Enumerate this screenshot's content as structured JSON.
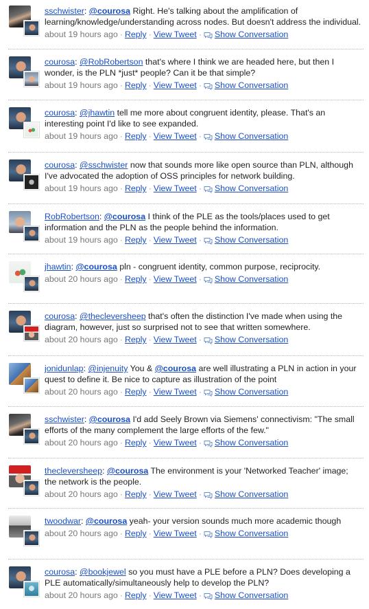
{
  "meta_labels": {
    "reply": "Reply",
    "view_tweet": "View Tweet",
    "show_conversation": "Show Conversation"
  },
  "tweets": [
    {
      "author": "sschwister",
      "sep": ": ",
      "mention": "@courosa",
      "mention_bold": true,
      "text": " Right. He's talking about the amplification of learning/knowledge/understanding across nodes. But doesn't address the individual.",
      "time": "about 19 hours ago",
      "avatar_main": "face-dark",
      "avatar_reply": "face-couro"
    },
    {
      "author": "courosa",
      "sep": ": ",
      "mention": "@RobRobertson",
      "mention_bold": false,
      "text": " that's where I think we are headed here, but then I wonder, is the PLN *just* people? Can it be that simple?",
      "time": "about 19 hours ago",
      "avatar_main": "face-couro",
      "avatar_reply": "face-rob"
    },
    {
      "author": "courosa",
      "sep": ": ",
      "mention": "@jhawtin",
      "mention_bold": false,
      "text": " tell me more about congruent identity, please. That's an interesting point I'd like to see expanded.",
      "time": "about 19 hours ago",
      "avatar_main": "face-couro",
      "avatar_reply": "face-jh"
    },
    {
      "author": "courosa",
      "sep": ": ",
      "mention": "@sschwister",
      "mention_bold": false,
      "text": " now that sounds more like open source than PLN, although I've advocated the adoption of OSS principles for network building.",
      "time": "about 19 hours ago",
      "avatar_main": "face-couro",
      "avatar_reply": "face-ssch-small"
    },
    {
      "author": "RobRobertson",
      "sep": ": ",
      "mention": "@courosa",
      "mention_bold": true,
      "text": " I think of the PLE as the tools/places used to get information and the PLN as the people behind the information.",
      "time": "about 19 hours ago",
      "avatar_main": "face-rob",
      "avatar_reply": "face-couro"
    },
    {
      "author": "jhawtin",
      "sep": ": ",
      "mention": "@courosa",
      "mention_bold": true,
      "text": " pln - congruent identity, common purpose, reciprocity.",
      "time": "about 20 hours ago",
      "avatar_main": "face-jh",
      "avatar_reply": "face-couro"
    },
    {
      "author": "courosa",
      "sep": ": ",
      "mention": "@thecleversheep",
      "mention_bold": false,
      "text": " that's often the distinction I've made when using the diagram, however, just so surprised not to see that written somewhere.",
      "time": "about 20 hours ago",
      "avatar_main": "face-couro",
      "avatar_reply": "face-sheep"
    },
    {
      "author": "jonidunlap",
      "sep": ": ",
      "mention": "@injenuity",
      "mention_bold": false,
      "mid": " You & ",
      "mention2": "@courosa",
      "text": " are well illustrating a PLN in action in your quest to define it. Be nice to capture as illustration of the point",
      "time": "about 20 hours ago",
      "avatar_main": "face-jon",
      "avatar_reply": "face-jon"
    },
    {
      "author": "sschwister",
      "sep": ": ",
      "mention": "@courosa",
      "mention_bold": true,
      "text": " I'd add Seely Brown via Siemens' connectivism: \"The small efforts of the many complement the large efforts of the few.\"",
      "time": "about 20 hours ago",
      "avatar_main": "face-dark",
      "avatar_reply": "face-couro"
    },
    {
      "author": "thecleversheep",
      "sep": ": ",
      "mention": "@courosa",
      "mention_bold": true,
      "text": " The environment is your 'Networked Teacher' image; the network is the people.",
      "time": "about 20 hours ago",
      "avatar_main": "face-sheep",
      "avatar_reply": "face-couro"
    },
    {
      "author": "twoodwar",
      "sep": ": ",
      "mention": "@courosa",
      "mention_bold": true,
      "text": " yeah- your version sounds much more academic though",
      "time": "about 20 hours ago",
      "avatar_main": "face-twood",
      "avatar_reply": "face-couro"
    },
    {
      "author": "courosa",
      "sep": ": ",
      "mention": "@bookjewel",
      "mention_bold": false,
      "text": " so you must have a PLE before a PLN? Does developing a PLE automatically/simultaneously help to develop the PLN?",
      "time": "about 20 hours ago",
      "avatar_main": "face-couro",
      "avatar_reply": "face-book"
    }
  ]
}
